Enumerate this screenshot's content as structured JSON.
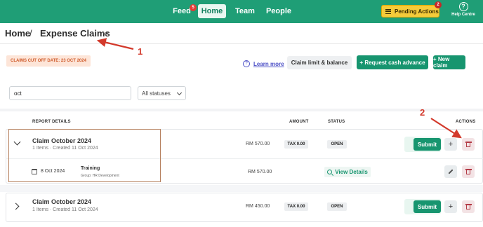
{
  "nav": {
    "feed": "Feed",
    "feed_badge": "5",
    "home": "Home",
    "team": "Team",
    "people": "People",
    "pending_actions": "Pending Actions",
    "pending_badge": "2",
    "help_centre": "Help Centre",
    "accent_color": "#1f9e76"
  },
  "breadcrumb": {
    "home": "Home",
    "separator": "/",
    "page": "Expense Claims"
  },
  "annotations": {
    "one": "1",
    "two": "2",
    "color": "#d33a2c"
  },
  "toolbar": {
    "cutoff": "CLAIMS CUT OFF DATE: 23 OCT 2024",
    "learn_more": "Learn more",
    "claim_limit": "Claim limit & balance",
    "request_advance": "+ Request cash advance",
    "new_claim": "+ New claim"
  },
  "filters": {
    "search_value": "oct",
    "status_selected": "All statuses"
  },
  "table": {
    "headers": {
      "report_details": "REPORT DETAILS",
      "amount": "AMOUNT",
      "status": "STATUS",
      "actions": "ACTIONS"
    },
    "rows": [
      {
        "title": "Claim October 2024",
        "subtitle": "1 Items · Created 11 Oct 2024",
        "amount": "RM 570.00",
        "tax": "TAX 0.00",
        "status": "OPEN",
        "submit": "Submit",
        "plus": "+",
        "expanded": true,
        "item": {
          "date": "8 Oct 2024",
          "type": "Training",
          "group": "Group: HR Development",
          "amount": "RM 570.00",
          "view_details": "View Details"
        }
      },
      {
        "title": "Claim October 2024",
        "subtitle": "1 Items · Created 11 Oct 2024",
        "amount": "RM 450.00",
        "tax": "TAX 0.00",
        "status": "OPEN",
        "submit": "Submit",
        "plus": "+",
        "expanded": false
      }
    ]
  }
}
